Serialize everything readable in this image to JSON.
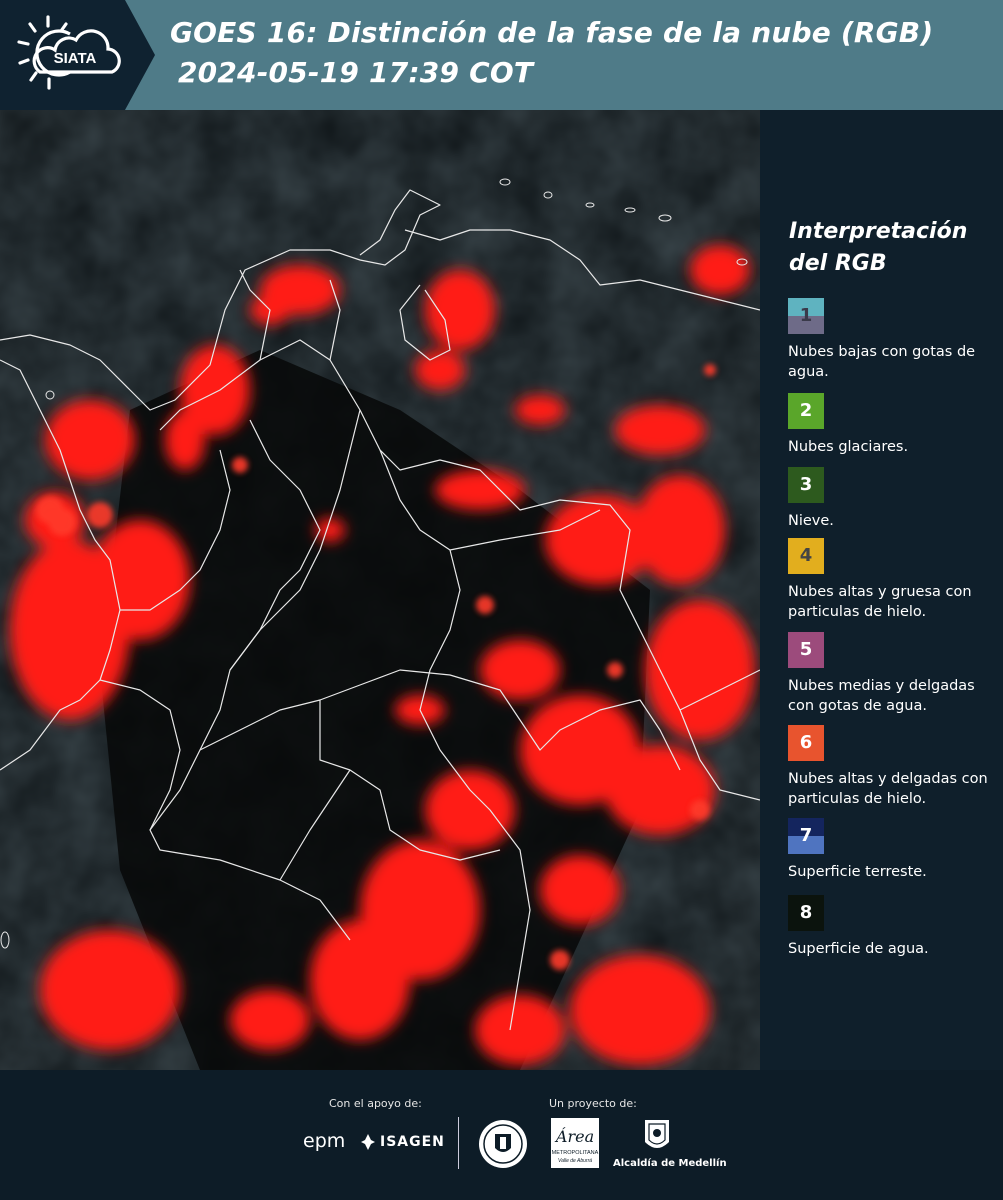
{
  "header": {
    "logo_text": "SIATA",
    "title_line1": "GOES 16: Distinción de la fase de la nube (RGB)",
    "title_line2": "2024-05-19 17:39 COT"
  },
  "legend": {
    "title_line1": "Interpretación",
    "title_line2": "del RGB",
    "items": [
      {
        "num": "1",
        "label": "Nubes bajas con gotas de agua.",
        "top_color": "#5fb3c0",
        "bottom_color": "#6e6b88",
        "num_color": "#3a3a4a"
      },
      {
        "num": "2",
        "label": "Nubes glaciares.",
        "top_color": "#5aa62a",
        "bottom_color": "#5aa62a",
        "num_color": "#ffffff"
      },
      {
        "num": "3",
        "label": "Nieve.",
        "top_color": "#2d5a1e",
        "bottom_color": "#2d5a1e",
        "num_color": "#ffffff"
      },
      {
        "num": "4",
        "label": "Nubes altas y gruesa con particulas de hielo.",
        "top_color": "#e2ae1e",
        "bottom_color": "#e2ae1e",
        "num_color": "#444444"
      },
      {
        "num": "5",
        "label": "Nubes medias y delgadas con gotas de agua.",
        "top_color": "#9c4b7c",
        "bottom_color": "#9c4b7c",
        "num_color": "#ffffff"
      },
      {
        "num": "6",
        "label": "Nubes altas y delgadas con particulas de hielo.",
        "top_color": "#e8542e",
        "bottom_color": "#e8542e",
        "num_color": "#ffffff"
      },
      {
        "num": "7",
        "label": "Superficie terreste.",
        "top_color": "#14255e",
        "bottom_color": "#4f74c0",
        "num_color": "#ffffff"
      },
      {
        "num": "8",
        "label": "Superficie de agua.",
        "top_color": "#0b130d",
        "bottom_color": "#0b130d",
        "num_color": "#ffffff"
      }
    ]
  },
  "footer": {
    "support_label": "Con el apoyo de:",
    "project_label": "Un proyecto de:",
    "sponsor_epm": "epm",
    "sponsor_isagen": "ISAGEN",
    "area_metro_line1": "Área",
    "area_metro_line2": "METROPOLITANA",
    "area_metro_line3": "Valle de Aburrá",
    "alcaldia": "Alcaldía de Medellín"
  }
}
